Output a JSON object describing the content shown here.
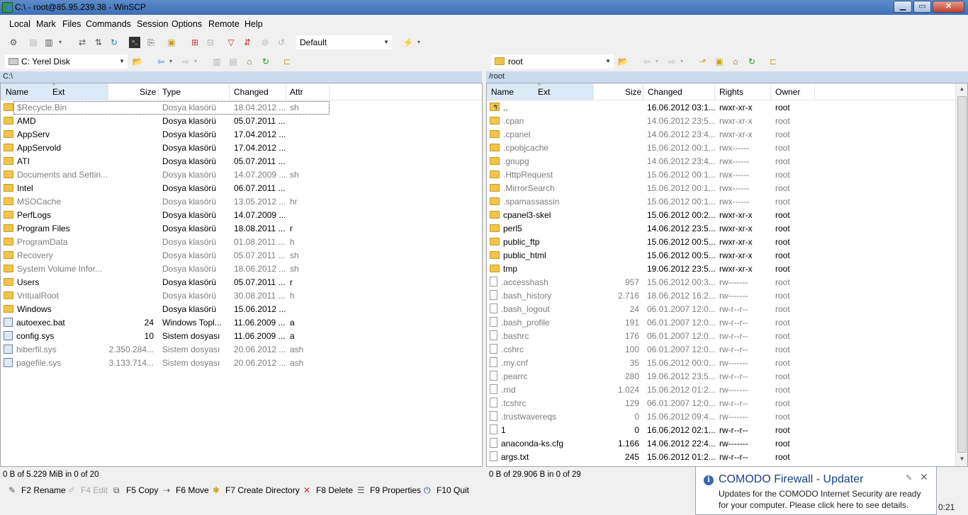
{
  "window": {
    "title": "C:\\ - root@85.95.239.38 - WinSCP",
    "minimize": "▁",
    "maximize": "▭",
    "close": "✕"
  },
  "menu": [
    "Local",
    "Mark",
    "Files",
    "Commands",
    "Session",
    "Options",
    "Remote",
    "Help"
  ],
  "toolbar": {
    "session_preset": "Default"
  },
  "left": {
    "drive": "C: Yerel Disk",
    "path": "C:\\",
    "columns": {
      "name": "Name",
      "ext": "Ext",
      "size": "Size",
      "type": "Type",
      "changed": "Changed",
      "attr": "Attr"
    },
    "rows": [
      {
        "name": "$Recycle.Bin",
        "size": "",
        "type": "Dosya klasörü",
        "changed": "18.04.2012 ...",
        "attr": "sh",
        "kind": "folder",
        "hidden": true
      },
      {
        "name": "AMD",
        "size": "",
        "type": "Dosya klasörü",
        "changed": "05.07.2011 ...",
        "attr": "",
        "kind": "folder",
        "hidden": false
      },
      {
        "name": "AppServ",
        "size": "",
        "type": "Dosya klasörü",
        "changed": "17.04.2012 ...",
        "attr": "",
        "kind": "folder",
        "hidden": false
      },
      {
        "name": "AppServold",
        "size": "",
        "type": "Dosya klasörü",
        "changed": "17.04.2012 ...",
        "attr": "",
        "kind": "folder",
        "hidden": false
      },
      {
        "name": "ATI",
        "size": "",
        "type": "Dosya klasörü",
        "changed": "05.07.2011 ...",
        "attr": "",
        "kind": "folder",
        "hidden": false
      },
      {
        "name": "Documents and Settin...",
        "size": "",
        "type": "Dosya klasörü",
        "changed": "14.07.2009 ...",
        "attr": "sh",
        "kind": "folder",
        "hidden": true
      },
      {
        "name": "Intel",
        "size": "",
        "type": "Dosya klasörü",
        "changed": "06.07.2011 ...",
        "attr": "",
        "kind": "folder",
        "hidden": false
      },
      {
        "name": "MSOCache",
        "size": "",
        "type": "Dosya klasörü",
        "changed": "13.05.2012 ...",
        "attr": "hr",
        "kind": "folder",
        "hidden": true
      },
      {
        "name": "PerfLogs",
        "size": "",
        "type": "Dosya klasörü",
        "changed": "14.07.2009 ...",
        "attr": "",
        "kind": "folder",
        "hidden": false
      },
      {
        "name": "Program Files",
        "size": "",
        "type": "Dosya klasörü",
        "changed": "18.08.2011 ...",
        "attr": "r",
        "kind": "folder",
        "hidden": false
      },
      {
        "name": "ProgramData",
        "size": "",
        "type": "Dosya klasörü",
        "changed": "01.08.2011 ...",
        "attr": "h",
        "kind": "folder",
        "hidden": true
      },
      {
        "name": "Recovery",
        "size": "",
        "type": "Dosya klasörü",
        "changed": "05.07.2011 ...",
        "attr": "sh",
        "kind": "folder",
        "hidden": true
      },
      {
        "name": "System Volume Infor...",
        "size": "",
        "type": "Dosya klasörü",
        "changed": "18.06.2012 ...",
        "attr": "sh",
        "kind": "folder",
        "hidden": true
      },
      {
        "name": "Users",
        "size": "",
        "type": "Dosya klasörü",
        "changed": "05.07.2011 ...",
        "attr": "r",
        "kind": "folder",
        "hidden": false
      },
      {
        "name": "VritualRoot",
        "size": "",
        "type": "Dosya klasörü",
        "changed": "30.08.2011 ...",
        "attr": "h",
        "kind": "folder",
        "hidden": true
      },
      {
        "name": "Windows",
        "size": "",
        "type": "Dosya klasörü",
        "changed": "15.06.2012 ...",
        "attr": "",
        "kind": "folder",
        "hidden": false
      },
      {
        "name": "autoexec.bat",
        "size": "24",
        "type": "Windows Topl...",
        "changed": "11.06.2009 ...",
        "attr": "a",
        "kind": "bat",
        "hidden": false
      },
      {
        "name": "config.sys",
        "size": "10",
        "type": "Sistem dosyası",
        "changed": "11.06.2009 ...",
        "attr": "a",
        "kind": "bat",
        "hidden": false
      },
      {
        "name": "hiberfil.sys",
        "size": "2.350.284...",
        "type": "Sistem dosyası",
        "changed": "20.06.2012 ...",
        "attr": "ash",
        "kind": "bat",
        "hidden": true
      },
      {
        "name": "pagefile.sys",
        "size": "3.133.714...",
        "type": "Sistem dosyası",
        "changed": "20.06.2012 ...",
        "attr": "ash",
        "kind": "bat",
        "hidden": true
      }
    ],
    "status": "0 B of 5.229 MiB in 0 of 20"
  },
  "right": {
    "dir": "root",
    "path": "/root",
    "columns": {
      "name": "Name",
      "ext": "Ext",
      "size": "Size",
      "changed": "Changed",
      "rights": "Rights",
      "owner": "Owner"
    },
    "rows": [
      {
        "name": "..",
        "size": "",
        "changed": "16.06.2012 03:1...",
        "rights": "rwxr-xr-x",
        "owner": "root",
        "kind": "up",
        "hidden": false
      },
      {
        "name": ".cpan",
        "size": "",
        "changed": "14.06.2012 23:5...",
        "rights": "rwxr-xr-x",
        "owner": "root",
        "kind": "folder",
        "hidden": true
      },
      {
        "name": ".cpanel",
        "size": "",
        "changed": "14.06.2012 23:4...",
        "rights": "rwxr-xr-x",
        "owner": "root",
        "kind": "folder",
        "hidden": true
      },
      {
        "name": ".cpobjcache",
        "size": "",
        "changed": "15.06.2012 00:1...",
        "rights": "rwx------",
        "owner": "root",
        "kind": "folder",
        "hidden": true
      },
      {
        "name": ".gnupg",
        "size": "",
        "changed": "14.06.2012 23:4...",
        "rights": "rwx------",
        "owner": "root",
        "kind": "folder",
        "hidden": true
      },
      {
        "name": ".HttpRequest",
        "size": "",
        "changed": "15.06.2012 00:1...",
        "rights": "rwx------",
        "owner": "root",
        "kind": "folder",
        "hidden": true
      },
      {
        "name": ".MirrorSearch",
        "size": "",
        "changed": "15.06.2012 00:1...",
        "rights": "rwx------",
        "owner": "root",
        "kind": "folder",
        "hidden": true
      },
      {
        "name": ".spamassassin",
        "size": "",
        "changed": "15.06.2012 00:1...",
        "rights": "rwx------",
        "owner": "root",
        "kind": "folder",
        "hidden": true
      },
      {
        "name": "cpanel3-skel",
        "size": "",
        "changed": "15.06.2012 00:2...",
        "rights": "rwxr-xr-x",
        "owner": "root",
        "kind": "folder",
        "hidden": false
      },
      {
        "name": "perl5",
        "size": "",
        "changed": "14.06.2012 23:5...",
        "rights": "rwxr-xr-x",
        "owner": "root",
        "kind": "folder",
        "hidden": false
      },
      {
        "name": "public_ftp",
        "size": "",
        "changed": "15.06.2012 00:5...",
        "rights": "rwxr-xr-x",
        "owner": "root",
        "kind": "folder",
        "hidden": false
      },
      {
        "name": "public_html",
        "size": "",
        "changed": "15.06.2012 00:5...",
        "rights": "rwxr-xr-x",
        "owner": "root",
        "kind": "folder",
        "hidden": false
      },
      {
        "name": "tmp",
        "size": "",
        "changed": "19.06.2012 23:5...",
        "rights": "rwxr-xr-x",
        "owner": "root",
        "kind": "folder",
        "hidden": false
      },
      {
        "name": ".accesshash",
        "size": "957",
        "changed": "15.06.2012 00:3...",
        "rights": "rw-------",
        "owner": "root",
        "kind": "file",
        "hidden": true
      },
      {
        "name": ".bash_history",
        "size": "2.716",
        "changed": "18.06.2012 16:2...",
        "rights": "rw-------",
        "owner": "root",
        "kind": "file",
        "hidden": true
      },
      {
        "name": ".bash_logout",
        "size": "24",
        "changed": "06.01.2007 12:0...",
        "rights": "rw-r--r--",
        "owner": "root",
        "kind": "file",
        "hidden": true
      },
      {
        "name": ".bash_profile",
        "size": "191",
        "changed": "06.01.2007 12:0...",
        "rights": "rw-r--r--",
        "owner": "root",
        "kind": "file",
        "hidden": true
      },
      {
        "name": ".bashrc",
        "size": "176",
        "changed": "06.01.2007 12:0...",
        "rights": "rw-r--r--",
        "owner": "root",
        "kind": "file",
        "hidden": true
      },
      {
        "name": ".cshrc",
        "size": "100",
        "changed": "06.01.2007 12:0...",
        "rights": "rw-r--r--",
        "owner": "root",
        "kind": "file",
        "hidden": true
      },
      {
        "name": ".my.cnf",
        "size": "35",
        "changed": "15.06.2012 00:0...",
        "rights": "rw-------",
        "owner": "root",
        "kind": "file",
        "hidden": true
      },
      {
        "name": ".pearrc",
        "size": "280",
        "changed": "19.06.2012 23:5...",
        "rights": "rw-r--r--",
        "owner": "root",
        "kind": "file",
        "hidden": true
      },
      {
        "name": ".rnd",
        "size": "1.024",
        "changed": "15.06.2012 01:2...",
        "rights": "rw-------",
        "owner": "root",
        "kind": "file",
        "hidden": true
      },
      {
        "name": ".tcshrc",
        "size": "129",
        "changed": "06.01.2007 12:0...",
        "rights": "rw-r--r--",
        "owner": "root",
        "kind": "file",
        "hidden": true
      },
      {
        "name": ".trustwavereqs",
        "size": "0",
        "changed": "15.06.2012 09:4...",
        "rights": "rw-------",
        "owner": "root",
        "kind": "file",
        "hidden": true
      },
      {
        "name": "1",
        "size": "0",
        "changed": "16.06.2012 02:1...",
        "rights": "rw-r--r--",
        "owner": "root",
        "kind": "file",
        "hidden": false
      },
      {
        "name": "anaconda-ks.cfg",
        "size": "1.166",
        "changed": "14.06.2012 22:4...",
        "rights": "rw-------",
        "owner": "root",
        "kind": "file",
        "hidden": false
      },
      {
        "name": "args.txt",
        "size": "245",
        "changed": "15.06.2012 01:2...",
        "rights": "rw-r--r--",
        "owner": "root",
        "kind": "file",
        "hidden": false
      }
    ],
    "status": "0 B of 29.906 B in 0 of 29"
  },
  "fkeys": [
    {
      "label": "F2 Rename",
      "icon": "pencil-icon",
      "enabled": true
    },
    {
      "label": "F4 Edit",
      "icon": "edit-icon",
      "enabled": false
    },
    {
      "label": "F5 Copy",
      "icon": "copy-icon",
      "enabled": true
    },
    {
      "label": "F6 Move",
      "icon": "move-icon",
      "enabled": true
    },
    {
      "label": "F7 Create Directory",
      "icon": "new-folder-icon",
      "enabled": true
    },
    {
      "label": "F8 Delete",
      "icon": "delete-icon",
      "enabled": true
    },
    {
      "label": "F9 Properties",
      "icon": "properties-icon",
      "enabled": true
    },
    {
      "label": "F10 Quit",
      "icon": "quit-icon",
      "enabled": true
    }
  ],
  "notification": {
    "title": "COMODO Firewall - Updater",
    "body": "Updates for the COMODO Internet Security are ready for your computer. Please click here to see details."
  },
  "clock": "0:21",
  "colors": {
    "titlebar": "#4a7bc0",
    "hidden_text": "#7d7d7d",
    "folder": "#f1c54c",
    "path_bar": "#c9d9ee",
    "sorted_col": "#dce9f6"
  }
}
